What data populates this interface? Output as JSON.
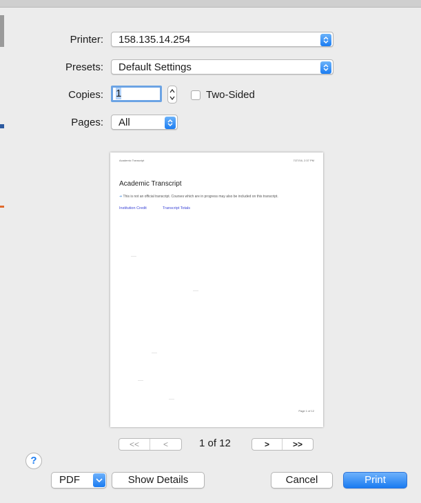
{
  "form": {
    "printer_label": "Printer:",
    "printer_value": "158.135.14.254",
    "presets_label": "Presets:",
    "presets_value": "Default Settings",
    "copies_label": "Copies:",
    "copies_value": "1",
    "two_sided_label": "Two-Sided",
    "two_sided_checked": false,
    "pages_label": "Pages:",
    "pages_value": "All"
  },
  "preview": {
    "header_left": "Academic Transcript",
    "header_right": "7/27/16, 2:37 PM",
    "title": "Academic Transcript",
    "note": "This is not an official transcript. Courses which are in progress may also be included on this transcript.",
    "links": [
      "Institution Credit",
      "Transcript Totals"
    ],
    "footer": "Page 1 of 12"
  },
  "pager": {
    "first": "<<",
    "prev": "<",
    "indicator": "1 of 12",
    "next": ">",
    "last": ">>"
  },
  "buttons": {
    "help": "?",
    "pdf": "PDF",
    "show_details": "Show Details",
    "cancel": "Cancel",
    "print": "Print"
  },
  "colors": {
    "accent": "#1b7cf2",
    "focus_ring": "#6ba3e4",
    "link": "#3b44d6"
  }
}
